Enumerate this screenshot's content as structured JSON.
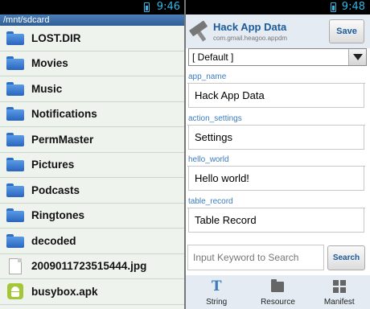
{
  "left_pane": {
    "status": {
      "time": "9:46"
    },
    "path": "/mnt/sdcard",
    "files": [
      {
        "name": "LOST.DIR",
        "icon": "folder-icon"
      },
      {
        "name": "Movies",
        "icon": "folder-icon"
      },
      {
        "name": "Music",
        "icon": "folder-icon"
      },
      {
        "name": "Notifications",
        "icon": "folder-icon"
      },
      {
        "name": "PermMaster",
        "icon": "folder-icon"
      },
      {
        "name": "Pictures",
        "icon": "folder-icon"
      },
      {
        "name": "Podcasts",
        "icon": "folder-icon"
      },
      {
        "name": "Ringtones",
        "icon": "folder-icon"
      },
      {
        "name": "decoded",
        "icon": "folder-icon"
      },
      {
        "name": "2009011723515444.jpg",
        "icon": "file-icon"
      },
      {
        "name": "busybox.apk",
        "icon": "apk-icon"
      }
    ]
  },
  "right_pane": {
    "status": {
      "time": "9:48"
    },
    "header": {
      "title": "Hack App Data",
      "package": "com.gmail.heagoo.appdm",
      "save_label": "Save"
    },
    "language_select": {
      "value": "[ Default ]"
    },
    "strings": [
      {
        "key": "app_name",
        "value": "Hack App Data"
      },
      {
        "key": "action_settings",
        "value": "Settings"
      },
      {
        "key": "hello_world",
        "value": "Hello world!"
      },
      {
        "key": "table_record",
        "value": "Table Record"
      }
    ],
    "search": {
      "placeholder": "Input Keyword to Search",
      "button_label": "Search"
    },
    "tabs": [
      {
        "label": "String",
        "icon": "text-icon"
      },
      {
        "label": "Resource",
        "icon": "folder-icon"
      },
      {
        "label": "Manifest",
        "icon": "grid-icon"
      }
    ]
  },
  "colors": {
    "accent": "#3a7bbf",
    "status_text": "#33b5e5",
    "path_bar": "#2f5d96",
    "list_bg": "#eef3ee"
  }
}
